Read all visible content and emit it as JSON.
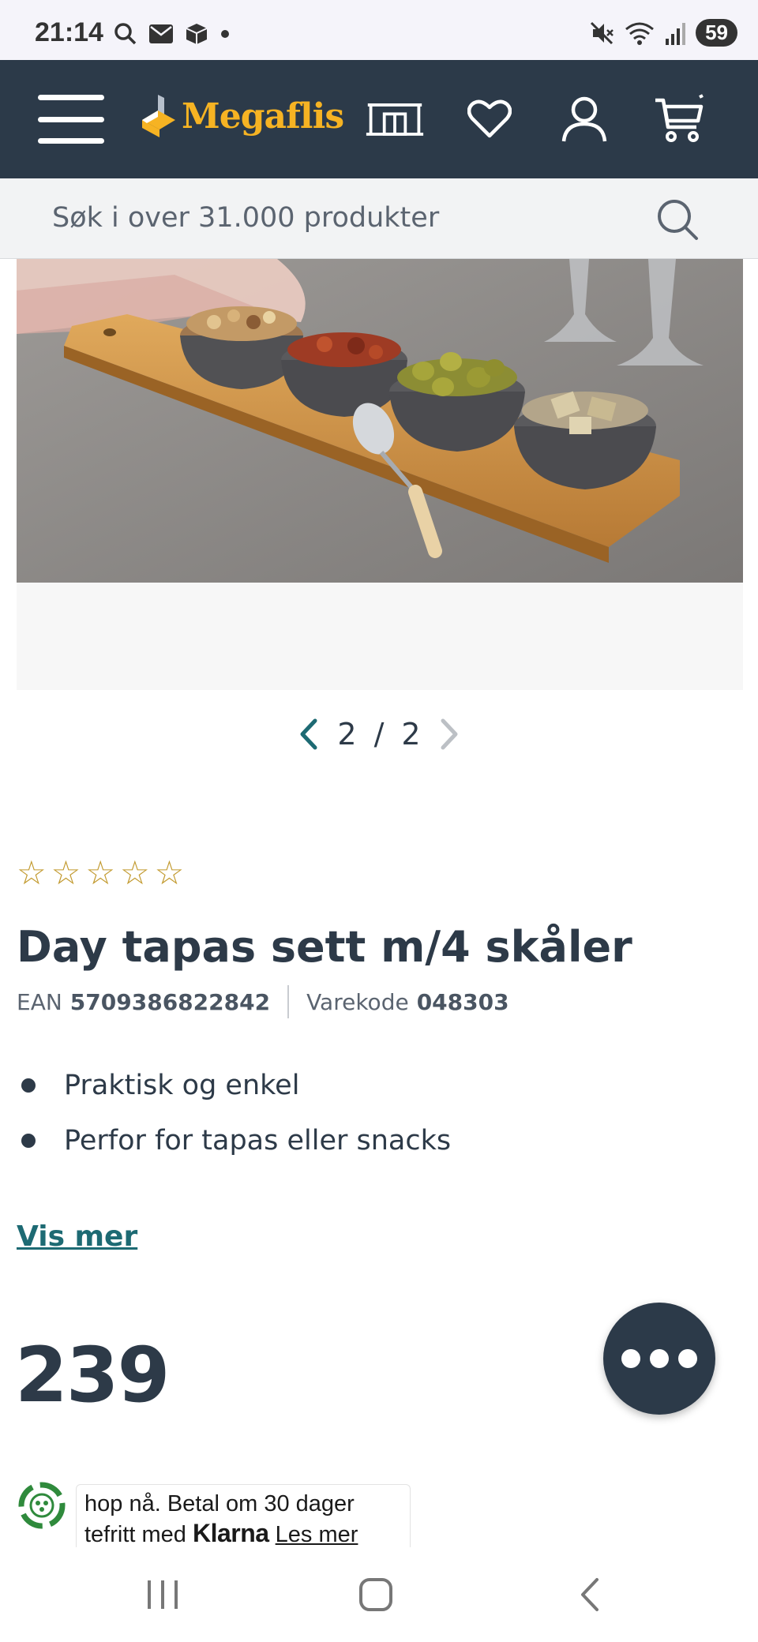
{
  "status_bar": {
    "time": "21:14",
    "battery": "59",
    "icons": [
      "search-icon",
      "mail-icon",
      "package-icon",
      "dot-icon",
      "mute-icon",
      "wifi-icon",
      "signal-icon"
    ]
  },
  "header": {
    "brand": "Megaflis",
    "icons": [
      "menu-icon",
      "store-icon",
      "heart-icon",
      "user-icon",
      "cart-icon"
    ],
    "colors": {
      "background": "#2c3a49",
      "brand": "#f6b323"
    }
  },
  "search": {
    "placeholder": "Søk i over 31.000 produkter"
  },
  "gallery": {
    "current": "2",
    "separator": "/",
    "total": "2"
  },
  "product": {
    "rating": 0,
    "rating_max": 5,
    "title": "Day tapas sett m/4 skåler",
    "ean_label": "EAN",
    "ean": "5709386822842",
    "code_label": "Varekode",
    "code": "048303",
    "bullets": [
      "Praktisk og enkel",
      "Perfor for tapas eller snacks"
    ],
    "show_more": "Vis mer",
    "price": "239"
  },
  "klarna": {
    "line1": "hop nå. Betal om 30 dager",
    "line2_prefix": "tefritt med",
    "brand": "Klarna",
    "link": "Les mer"
  },
  "nav": {
    "icons": [
      "recents-icon",
      "home-icon",
      "back-icon"
    ]
  }
}
